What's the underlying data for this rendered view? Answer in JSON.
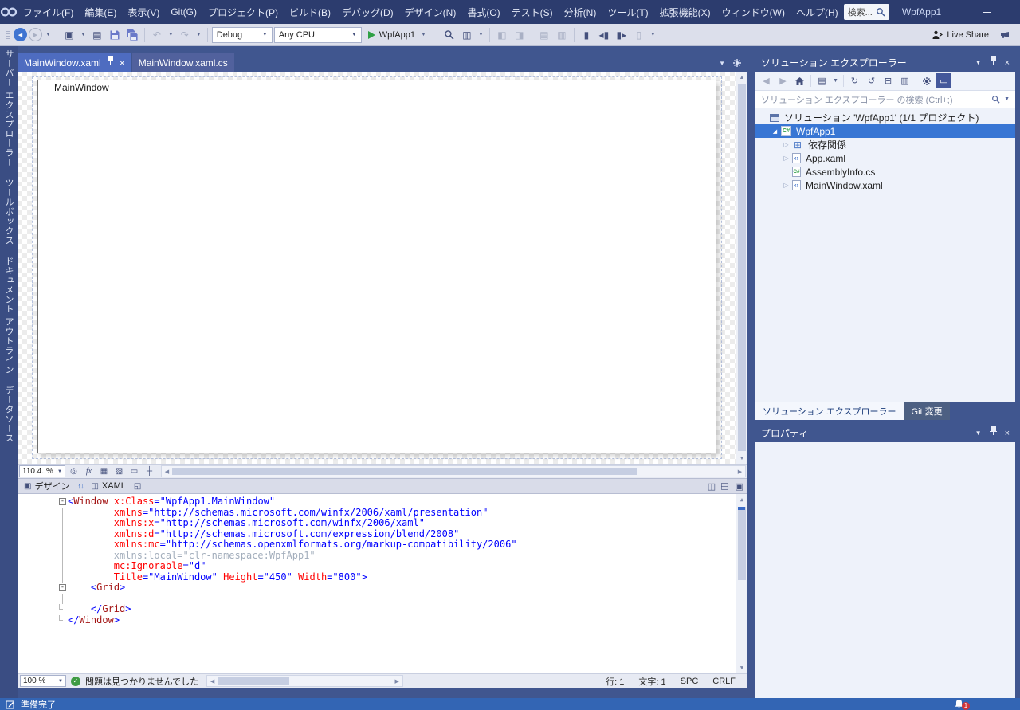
{
  "title_bar": {
    "menus": [
      "ファイル(F)",
      "編集(E)",
      "表示(V)",
      "Git(G)",
      "プロジェクト(P)",
      "ビルド(B)",
      "デバッグ(D)",
      "デザイン(N)",
      "書式(O)",
      "テスト(S)",
      "分析(N)",
      "ツール(T)",
      "拡張機能(X)",
      "ウィンドウ(W)",
      "ヘルプ(H)"
    ],
    "search_placeholder": "検索...",
    "app_title": "WpfApp1"
  },
  "toolbar": {
    "debug_config": "Debug",
    "platform": "Any CPU",
    "run_target": "WpfApp1",
    "live_share_label": "Live Share"
  },
  "left_tabs": [
    "サーバー エクスプローラー",
    "ツールボックス",
    "ドキュメント アウトライン",
    "データソース"
  ],
  "doc_tabs": [
    {
      "label": "MainWindow.xaml",
      "active": true
    },
    {
      "label": "MainWindow.xaml.cs",
      "active": false
    }
  ],
  "designer": {
    "window_title": "MainWindow",
    "zoom": "110.4..%"
  },
  "split_bar": {
    "design_label": "デザイン",
    "xaml_label": "XAML"
  },
  "editor": {
    "zoom": "100 %",
    "status_message": "問題は見つかりませんでした",
    "line_label": "行: 1",
    "column_label": "文字: 1",
    "encoding_label": "SPC",
    "eol_label": "CRLF",
    "folds": [
      {
        "start": 0,
        "end": 11
      },
      {
        "start": 8,
        "end": 10
      }
    ],
    "code_lines": [
      [
        [
          "d",
          "<"
        ],
        [
          "n",
          "Window"
        ],
        [
          "p",
          " "
        ],
        [
          "a",
          "x:Class"
        ],
        [
          "d",
          "=\""
        ],
        [
          "v",
          "WpfApp1.MainWindow"
        ],
        [
          "d",
          "\""
        ]
      ],
      [
        [
          "p",
          "        "
        ],
        [
          "a",
          "xmlns"
        ],
        [
          "d",
          "=\""
        ],
        [
          "v",
          "http://schemas.microsoft.com/winfx/2006/xaml/presentation"
        ],
        [
          "d",
          "\""
        ]
      ],
      [
        [
          "p",
          "        "
        ],
        [
          "a",
          "xmlns:x"
        ],
        [
          "d",
          "=\""
        ],
        [
          "v",
          "http://schemas.microsoft.com/winfx/2006/xaml"
        ],
        [
          "d",
          "\""
        ]
      ],
      [
        [
          "p",
          "        "
        ],
        [
          "a",
          "xmlns:d"
        ],
        [
          "d",
          "=\""
        ],
        [
          "v",
          "http://schemas.microsoft.com/expression/blend/2008"
        ],
        [
          "d",
          "\""
        ]
      ],
      [
        [
          "p",
          "        "
        ],
        [
          "a",
          "xmlns:mc"
        ],
        [
          "d",
          "=\""
        ],
        [
          "v",
          "http://schemas.openxmlformats.org/markup-compatibility/2006"
        ],
        [
          "d",
          "\""
        ]
      ],
      [
        [
          "p",
          "        "
        ],
        [
          "g",
          "xmlns:local=\"clr-namespace:WpfApp1\""
        ]
      ],
      [
        [
          "p",
          "        "
        ],
        [
          "a",
          "mc:Ignorable"
        ],
        [
          "d",
          "=\""
        ],
        [
          "v",
          "d"
        ],
        [
          "d",
          "\""
        ]
      ],
      [
        [
          "p",
          "        "
        ],
        [
          "a",
          "Title"
        ],
        [
          "d",
          "=\""
        ],
        [
          "v",
          "MainWindow"
        ],
        [
          "d",
          "\""
        ],
        [
          "p",
          " "
        ],
        [
          "a",
          "Height"
        ],
        [
          "d",
          "=\""
        ],
        [
          "v",
          "450"
        ],
        [
          "d",
          "\""
        ],
        [
          "p",
          " "
        ],
        [
          "a",
          "Width"
        ],
        [
          "d",
          "=\""
        ],
        [
          "v",
          "800"
        ],
        [
          "d",
          "\""
        ],
        [
          "d",
          ">"
        ]
      ],
      [
        [
          "p",
          "    "
        ],
        [
          "d",
          "<"
        ],
        [
          "n",
          "Grid"
        ],
        [
          "d",
          ">"
        ]
      ],
      [
        [
          "p",
          ""
        ]
      ],
      [
        [
          "p",
          "    "
        ],
        [
          "d",
          "</"
        ],
        [
          "n",
          "Grid"
        ],
        [
          "d",
          ">"
        ]
      ],
      [
        [
          "d",
          "</"
        ],
        [
          "n",
          "Window"
        ],
        [
          "d",
          ">"
        ]
      ]
    ]
  },
  "solution_explorer": {
    "title": "ソリューション エクスプローラー",
    "search_placeholder": "ソリューション エクスプローラー の検索 (Ctrl+;)",
    "tree": [
      {
        "label": "ソリューション 'WpfApp1' (1/1 プロジェクト)",
        "indent": 0,
        "icon": "solution",
        "expander": "none",
        "selected": false
      },
      {
        "label": "WpfApp1",
        "indent": 1,
        "icon": "csproj",
        "expander": "expanded",
        "selected": true
      },
      {
        "label": "依存関係",
        "indent": 2,
        "icon": "dependencies",
        "expander": "collapsed",
        "selected": false
      },
      {
        "label": "App.xaml",
        "indent": 2,
        "icon": "xaml",
        "expander": "collapsed",
        "selected": false
      },
      {
        "label": "AssemblyInfo.cs",
        "indent": 2,
        "icon": "cs",
        "expander": "none",
        "selected": false
      },
      {
        "label": "MainWindow.xaml",
        "indent": 2,
        "icon": "xaml",
        "expander": "collapsed",
        "selected": false
      }
    ],
    "bottom_tabs": [
      {
        "label": "ソリューション エクスプローラー",
        "selected": true
      },
      {
        "label": "Git 変更",
        "selected": false
      }
    ]
  },
  "properties": {
    "title": "プロパティ"
  },
  "status_bar": {
    "message": "準備完了",
    "notification_count": "1"
  }
}
